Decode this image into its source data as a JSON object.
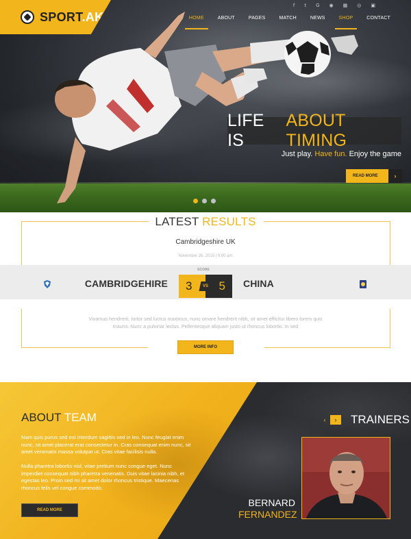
{
  "brand": {
    "name_part1": "SPORT",
    "name_part2": ".AK"
  },
  "social": [
    "f",
    "t",
    "G",
    "◉",
    "▦",
    "◎",
    "▣"
  ],
  "nav": [
    {
      "label": "HOME",
      "active": true
    },
    {
      "label": "ABOUT"
    },
    {
      "label": "PAGES"
    },
    {
      "label": "MATCH"
    },
    {
      "label": "NEWS"
    },
    {
      "label": "SHOP"
    },
    {
      "label": "CONTACT"
    }
  ],
  "hero": {
    "headline_white": "LIFE IS",
    "headline_yellow": "ABOUT TIMING",
    "tagline_1": "Just play.",
    "tagline_2": "Have fun.",
    "tagline_3": "Enjoy the game",
    "button": "READ MORE",
    "slides": 3,
    "active_slide": 1
  },
  "results": {
    "title_1": "LATEST",
    "title_2": "RESULTS",
    "venue": "Cambridgeshire UK",
    "date": "November 26, 2015 | 9:00 am",
    "score_label": "SCORE",
    "home_team": "CAMBRIDGEHIRE",
    "away_team": "CHINA",
    "home_score": "3",
    "away_score": "5",
    "vs": "VS",
    "blurb": "Vivamus hendrerit, tortor sed luctus maximus, nunc ornare hendrerit nibh, sit amet efficitur libero lorem quis mauris. Nunc a pulvinar lectus. Pellentesque aliquam justo ut rhoncus lobortis. In sed",
    "button": "MORE INFO"
  },
  "about": {
    "title_1": "ABOUT",
    "title_2": "TEAM",
    "para1": "Nam quis purus sed est interdum sagittis sed in leo. Nunc feugiat enim nunc, sit amet placerat erat consectetur in. Cras consequat enim nunc, sit amet venenatis massa volutpat ut. Cras vitae facilisis nulla.",
    "para2": "Nulla pharetra lobortis nisl, vitae pretium nunc congue eget. Nunc imperdiet consequat nibh pharetra venenatis. Duis vitae lacinia nibh, et egestas leo. Proin sed mi sit amet dolor rhoncus tristique. Maecenas rhoncus felis vel congue commodo.",
    "button": "READ MORE"
  },
  "trainers": {
    "title": "TRAINERS",
    "prev": "‹",
    "next": "›",
    "first_name": "BERNARD",
    "last_name": "FERNANDEZ"
  },
  "colors": {
    "accent": "#f2b51c",
    "dark": "#2b2b2b"
  }
}
